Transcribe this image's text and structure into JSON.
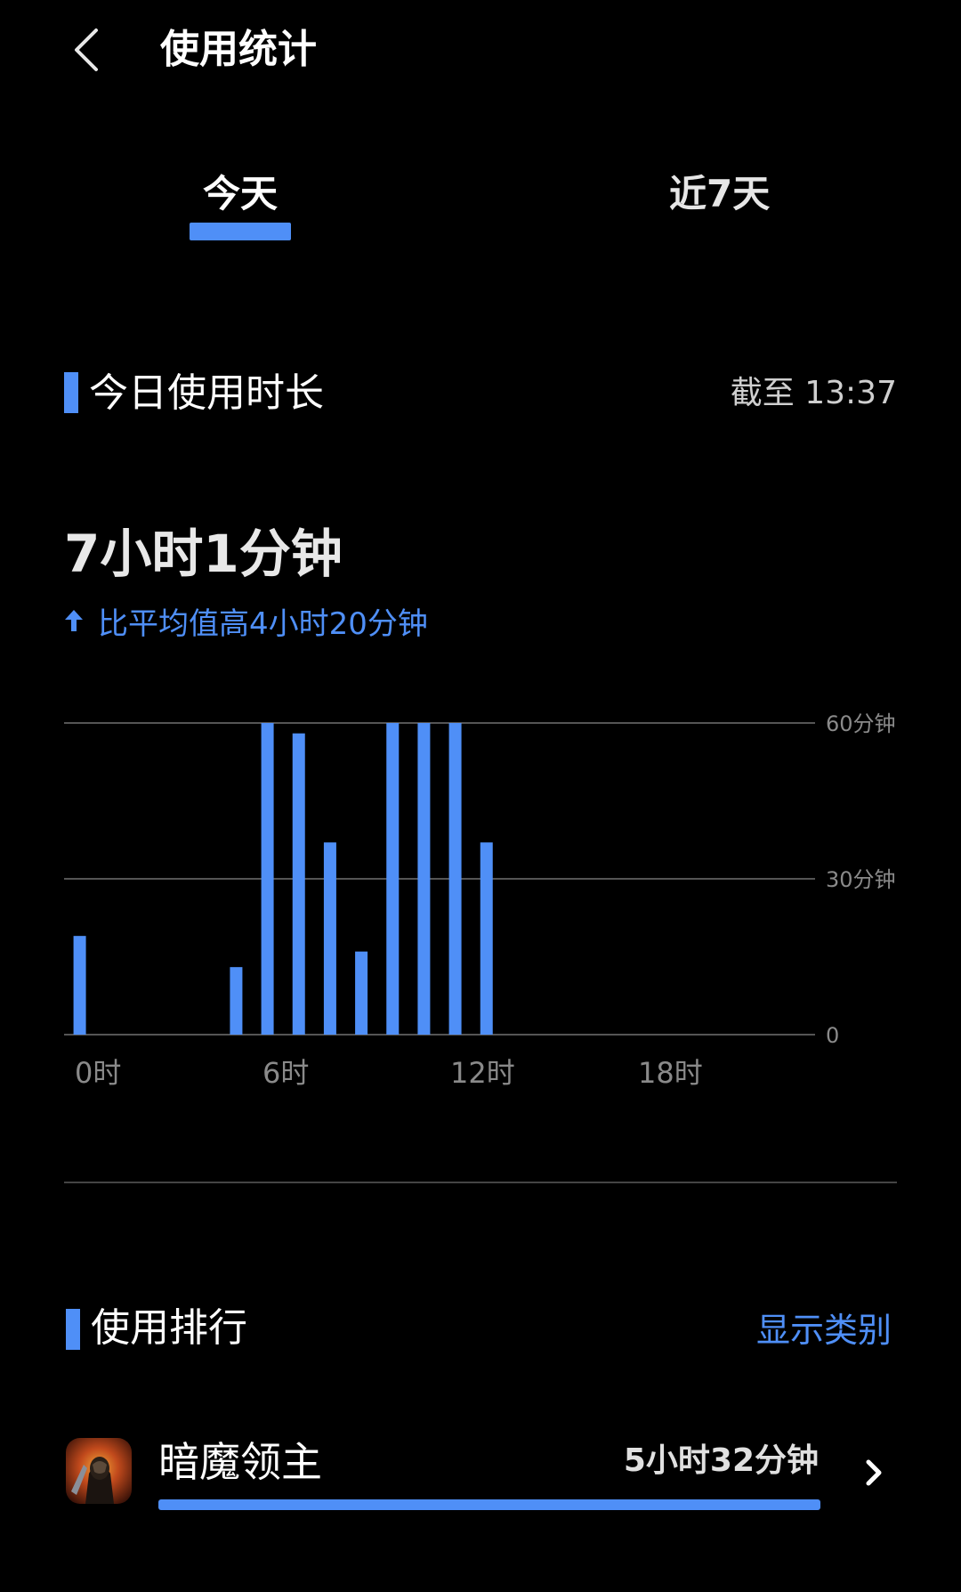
{
  "header": {
    "title": "使用统计",
    "back_icon": "chevron-left-icon"
  },
  "tabs": [
    {
      "label": "今天",
      "active": true
    },
    {
      "label": "近7天",
      "active": false
    }
  ],
  "usage_section": {
    "title": "今日使用时长",
    "as_of": "截至 13:37",
    "total": "7小时1分钟",
    "comparison": "比平均值高4小时20分钟",
    "comparison_icon": "arrow-up-icon"
  },
  "chart_data": {
    "type": "bar",
    "x": [
      0,
      1,
      2,
      3,
      4,
      5,
      6,
      7,
      8,
      9,
      10,
      11,
      12,
      13,
      14,
      15,
      16,
      17,
      18,
      19,
      20,
      21,
      22,
      23
    ],
    "values": [
      19,
      0,
      0,
      0,
      0,
      13,
      60,
      58,
      37,
      16,
      60,
      60,
      60,
      37,
      0,
      0,
      0,
      0,
      0,
      0,
      0,
      0,
      0,
      0
    ],
    "xticks": [
      {
        "hour": 0,
        "label": "0时"
      },
      {
        "hour": 6,
        "label": "6时"
      },
      {
        "hour": 12,
        "label": "12时"
      },
      {
        "hour": 18,
        "label": "18时"
      }
    ],
    "yticks": [
      {
        "value": 60,
        "label": "60分钟"
      },
      {
        "value": 30,
        "label": "30分钟"
      },
      {
        "value": 0,
        "label": "0"
      }
    ],
    "ylim": [
      0,
      60
    ],
    "grid": true,
    "color": "#4f8ff7"
  },
  "ranking_section": {
    "title": "使用排行",
    "show_category_label": "显示类别",
    "items": [
      {
        "name": "暗魔领主",
        "time": "5小时32分钟",
        "fraction": 1.0,
        "icon": "game-app-icon"
      }
    ]
  },
  "colors": {
    "accent": "#4f8ff7",
    "background": "#000000"
  }
}
